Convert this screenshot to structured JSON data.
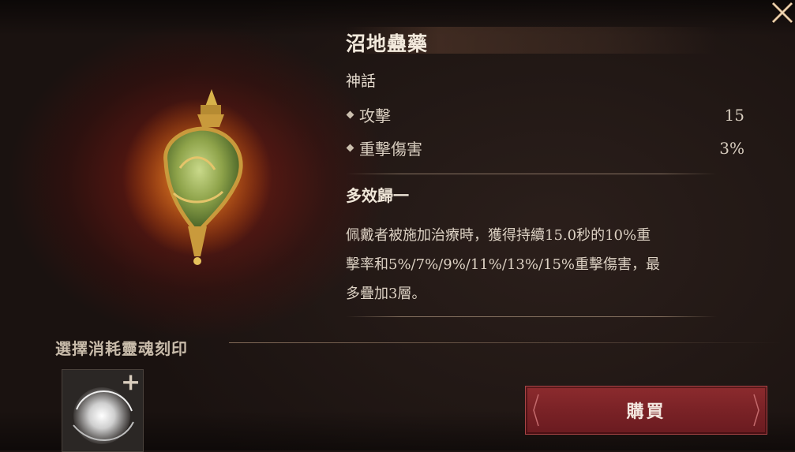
{
  "item": {
    "name": "沼地蠱藥",
    "rarity": "神話"
  },
  "stats": [
    {
      "label": "攻擊",
      "value": "15"
    },
    {
      "label": "重擊傷害",
      "value": "3%"
    }
  ],
  "effect": {
    "title": "多效歸一",
    "description_lines": [
      "佩戴者被施加治療時，獲得持續15.0秒的10%重",
      "擊率和5%/7%/9%/11%/13%/15%重擊傷害，最",
      "多疊加3層。"
    ]
  },
  "seal": {
    "label": "選擇消耗靈魂刻印",
    "add_symbol": "+"
  },
  "buy_button": {
    "label": "購買"
  },
  "icons": [
    "close-icon",
    "potion-icon",
    "soul-seal-icon",
    "add-icon",
    "diamond-bullet-icon"
  ],
  "colors": {
    "buy_button": "#7a2226",
    "background": "#1d1412",
    "accent_glow": "#961e14"
  }
}
